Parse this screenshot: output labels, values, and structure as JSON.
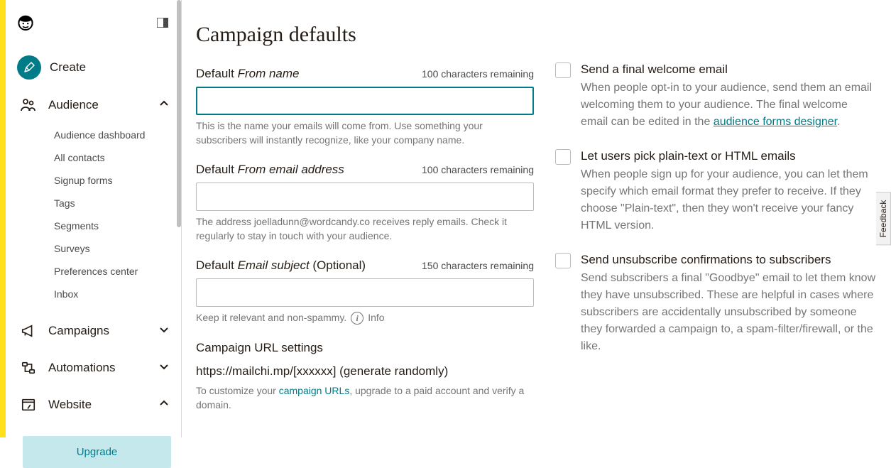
{
  "sidebar": {
    "create": "Create",
    "audience": {
      "label": "Audience",
      "items": [
        "Audience dashboard",
        "All contacts",
        "Signup forms",
        "Tags",
        "Segments",
        "Surveys",
        "Preferences center",
        "Inbox"
      ]
    },
    "campaigns": "Campaigns",
    "automations": "Automations",
    "website": "Website",
    "upgrade": "Upgrade"
  },
  "page": {
    "title": "Campaign defaults",
    "from_name": {
      "label_prefix": "Default ",
      "label_ital": "From name",
      "counter": "100 characters remaining",
      "value": "",
      "help": "This is the name your emails will come from. Use something your subscribers will instantly recognize, like your company name."
    },
    "from_email": {
      "label_prefix": "Default ",
      "label_ital": "From email address",
      "counter": "100 characters remaining",
      "value": "",
      "help": "The address joelladunn@wordcandy.co receives reply emails. Check it regularly to stay in touch with your audience."
    },
    "subject": {
      "label_prefix": "Default ",
      "label_ital": "Email subject",
      "label_suffix": " (Optional)",
      "counter": "150 characters remaining",
      "value": "",
      "help_pre": "Keep it relevant and non-spammy.",
      "info": "Info"
    },
    "url": {
      "heading": "Campaign URL settings",
      "text": "https://mailchi.mp/[xxxxxx] (generate randomly)",
      "help_pre": "To customize your ",
      "help_link": "campaign URLs",
      "help_post": ", upgrade to a paid account and verify a domain."
    }
  },
  "options": {
    "welcome": {
      "title": "Send a final welcome email",
      "desc_pre": "When people opt-in to your audience, send them an email welcoming them to your audience. The final welcome email can be edited in the ",
      "desc_link": "audience forms designer",
      "desc_post": "."
    },
    "plaintext": {
      "title": "Let users pick plain-text or HTML emails",
      "desc": "When people sign up for your audience, you can let them specify which email format they prefer to receive. If they choose \"Plain-text\", then they won't receive your fancy HTML version."
    },
    "unsub": {
      "title": "Send unsubscribe confirmations to subscribers",
      "desc": "Send subscribers a final \"Goodbye\" email to let them know they have unsubscribed. These are helpful in cases where subscribers are accidentally unsubscribed by someone they forwarded a campaign to, a spam-filter/firewall, or the like."
    }
  },
  "feedback": "Feedback"
}
